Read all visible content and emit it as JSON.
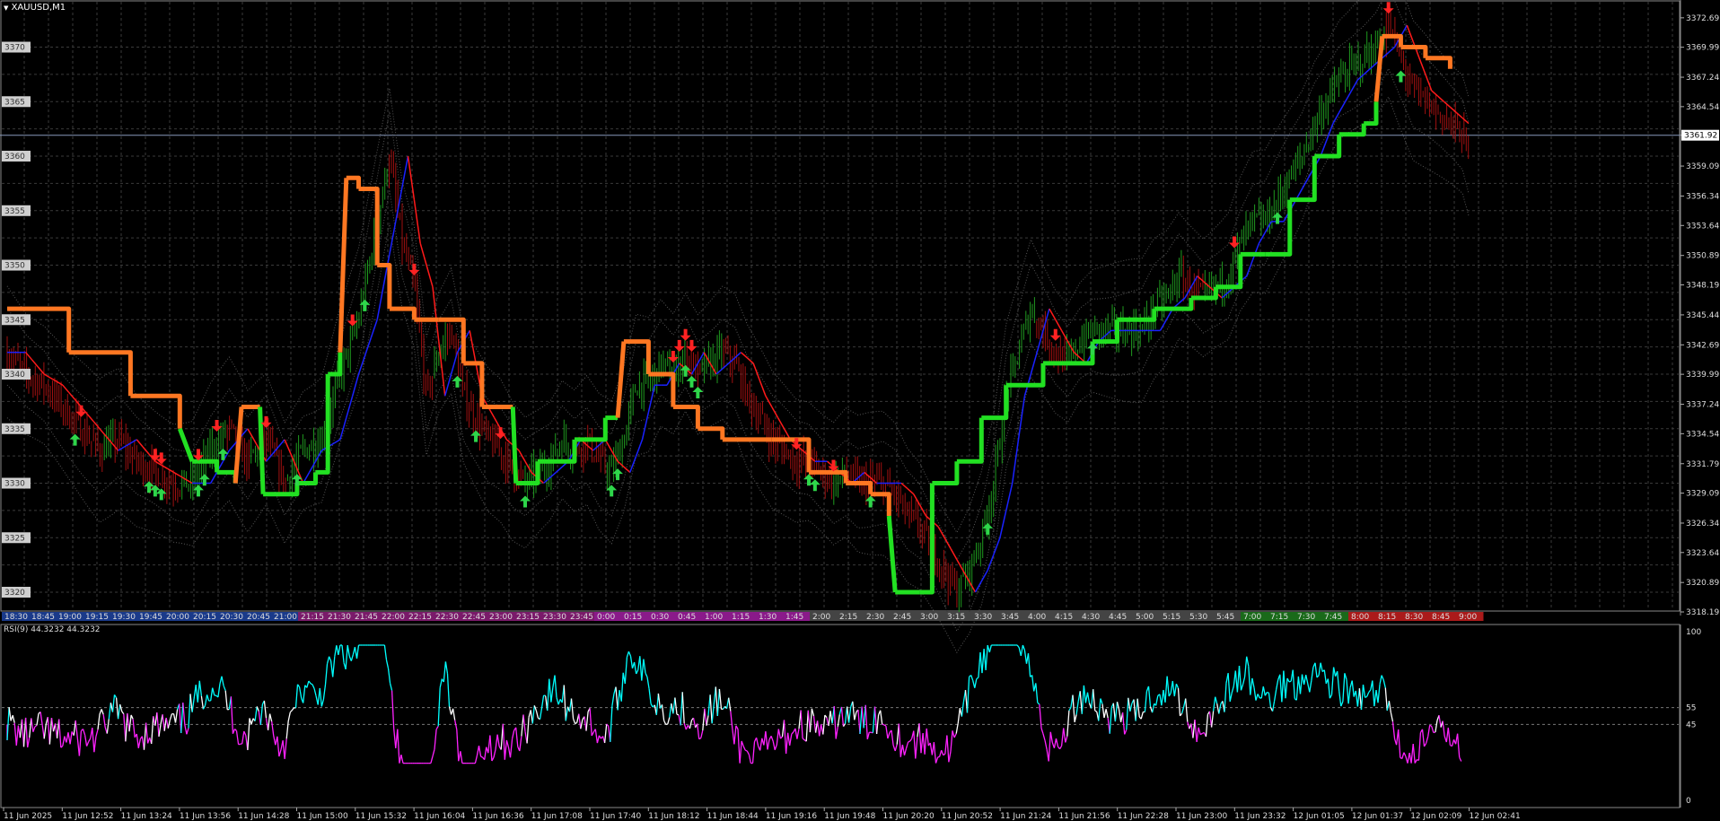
{
  "chart_title": "XAUUSD,M1",
  "rsi_label": "RSI(9) 44.3232 44.3232",
  "colors": {
    "background": "#000000",
    "grid": "#3a3a3a",
    "bull": "#1f9a1f",
    "bear": "#a01010",
    "supertrend_up": "#22e022",
    "supertrend_down": "#ff7722",
    "rsi_high": "#00ffff",
    "rsi_mid": "#ffffff",
    "rsi_low": "#ff22ff",
    "ma_blue": "#1a22ff",
    "ma_red": "#ff1a1a"
  },
  "price_axis": {
    "ticks": [
      "3372.69",
      "3369.99",
      "3367.24",
      "3364.54",
      "3361.92",
      "3359.09",
      "3356.34",
      "3353.64",
      "3350.89",
      "3348.19",
      "3345.44",
      "3342.69",
      "3339.99",
      "3337.24",
      "3334.54",
      "3331.79",
      "3329.09",
      "3326.34",
      "3323.64",
      "3320.89",
      "3318.19"
    ],
    "current_price": "3361.92"
  },
  "left_price_labels": [
    "3370",
    "3365",
    "3360",
    "3355",
    "3350",
    "3345",
    "3340",
    "3335",
    "3330",
    "3325",
    "3320"
  ],
  "session_times": [
    {
      "t": "18:30",
      "c": "#1a3a8a"
    },
    {
      "t": "18:45",
      "c": "#1a3a8a"
    },
    {
      "t": "19:00",
      "c": "#1a3a8a"
    },
    {
      "t": "19:15",
      "c": "#1a3a8a"
    },
    {
      "t": "19:30",
      "c": "#1a3a8a"
    },
    {
      "t": "19:45",
      "c": "#1a3a8a"
    },
    {
      "t": "20:00",
      "c": "#1a3a8a"
    },
    {
      "t": "20:15",
      "c": "#1a3a8a"
    },
    {
      "t": "20:30",
      "c": "#1a3a8a"
    },
    {
      "t": "20:45",
      "c": "#1a3a8a"
    },
    {
      "t": "21:00",
      "c": "#1a3a8a"
    },
    {
      "t": "21:15",
      "c": "#7a1a6a"
    },
    {
      "t": "21:30",
      "c": "#7a1a6a"
    },
    {
      "t": "21:45",
      "c": "#7a1a6a"
    },
    {
      "t": "22:00",
      "c": "#7a1a6a"
    },
    {
      "t": "22:15",
      "c": "#7a1a6a"
    },
    {
      "t": "22:30",
      "c": "#7a1a6a"
    },
    {
      "t": "22:45",
      "c": "#7a1a6a"
    },
    {
      "t": "23:00",
      "c": "#7a1a6a"
    },
    {
      "t": "23:15",
      "c": "#7a1a6a"
    },
    {
      "t": "23:30",
      "c": "#7a1a6a"
    },
    {
      "t": "23:45",
      "c": "#7a1a6a"
    },
    {
      "t": "0:00",
      "c": "#8a1a8a"
    },
    {
      "t": "0:15",
      "c": "#8a1a8a"
    },
    {
      "t": "0:30",
      "c": "#8a1a8a"
    },
    {
      "t": "0:45",
      "c": "#8a1a8a"
    },
    {
      "t": "1:00",
      "c": "#8a1a8a"
    },
    {
      "t": "1:15",
      "c": "#8a1a8a"
    },
    {
      "t": "1:30",
      "c": "#8a1a8a"
    },
    {
      "t": "1:45",
      "c": "#8a1a8a"
    },
    {
      "t": "2:00",
      "c": "#444444"
    },
    {
      "t": "2:15",
      "c": "#444444"
    },
    {
      "t": "2:30",
      "c": "#444444"
    },
    {
      "t": "2:45",
      "c": "#444444"
    },
    {
      "t": "3:00",
      "c": "#444444"
    },
    {
      "t": "3:15",
      "c": "#444444"
    },
    {
      "t": "3:30",
      "c": "#444444"
    },
    {
      "t": "3:45",
      "c": "#444444"
    },
    {
      "t": "4:00",
      "c": "#444444"
    },
    {
      "t": "4:15",
      "c": "#444444"
    },
    {
      "t": "4:30",
      "c": "#444444"
    },
    {
      "t": "4:45",
      "c": "#444444"
    },
    {
      "t": "5:00",
      "c": "#444444"
    },
    {
      "t": "5:15",
      "c": "#444444"
    },
    {
      "t": "5:30",
      "c": "#444444"
    },
    {
      "t": "5:45",
      "c": "#444444"
    },
    {
      "t": "7:00",
      "c": "#1a6a1a"
    },
    {
      "t": "7:15",
      "c": "#1a6a1a"
    },
    {
      "t": "7:30",
      "c": "#1a6a1a"
    },
    {
      "t": "7:45",
      "c": "#1a6a1a"
    },
    {
      "t": "8:00",
      "c": "#aa1a1a"
    },
    {
      "t": "8:15",
      "c": "#aa1a1a"
    },
    {
      "t": "8:30",
      "c": "#aa1a1a"
    },
    {
      "t": "8:45",
      "c": "#aa1a1a"
    },
    {
      "t": "9:00",
      "c": "#aa1a1a"
    }
  ],
  "time_axis": [
    "11 Jun 2025",
    "11 Jun 12:52",
    "11 Jun 13:24",
    "11 Jun 13:56",
    "11 Jun 14:28",
    "11 Jun 15:00",
    "11 Jun 15:32",
    "11 Jun 16:04",
    "11 Jun 16:36",
    "11 Jun 17:08",
    "11 Jun 17:40",
    "11 Jun 18:12",
    "11 Jun 18:44",
    "11 Jun 19:16",
    "11 Jun 19:48",
    "11 Jun 20:20",
    "11 Jun 20:52",
    "11 Jun 21:24",
    "11 Jun 21:56",
    "11 Jun 22:28",
    "11 Jun 23:00",
    "11 Jun 23:32",
    "12 Jun 01:05",
    "12 Jun 01:37",
    "12 Jun 02:09",
    "12 Jun 02:41"
  ],
  "rsi_axis": [
    "100",
    "55",
    "45",
    "0"
  ],
  "chart_data": {
    "type": "line",
    "title": "XAUUSD,M1",
    "ylim": [
      3318.19,
      3373.5
    ],
    "price_path": [
      [
        0,
        3342
      ],
      [
        3,
        3340
      ],
      [
        6,
        3339
      ],
      [
        9,
        3337
      ],
      [
        12,
        3335
      ],
      [
        15,
        3333
      ],
      [
        18,
        3334
      ],
      [
        21,
        3332
      ],
      [
        24,
        3331
      ],
      [
        27,
        3330
      ],
      [
        30,
        3330
      ],
      [
        33,
        3333
      ],
      [
        36,
        3335
      ],
      [
        39,
        3332
      ],
      [
        42,
        3334
      ],
      [
        45,
        3330
      ],
      [
        48,
        3333
      ],
      [
        51,
        3334
      ],
      [
        54,
        3340
      ],
      [
        57,
        3345
      ],
      [
        60,
        3354
      ],
      [
        62,
        3360
      ],
      [
        64,
        3352
      ],
      [
        66,
        3348
      ],
      [
        68,
        3338
      ],
      [
        70,
        3342
      ],
      [
        72,
        3344
      ],
      [
        74,
        3338
      ],
      [
        76,
        3336
      ],
      [
        78,
        3334
      ],
      [
        80,
        3333
      ],
      [
        82,
        3331
      ],
      [
        84,
        3330
      ],
      [
        86,
        3331
      ],
      [
        88,
        3332
      ],
      [
        90,
        3334
      ],
      [
        92,
        3333
      ],
      [
        94,
        3334
      ],
      [
        96,
        3332
      ],
      [
        98,
        3331
      ],
      [
        100,
        3334
      ],
      [
        102,
        3339
      ],
      [
        104,
        3339
      ],
      [
        106,
        3341
      ],
      [
        108,
        3340
      ],
      [
        110,
        3342
      ],
      [
        112,
        3340
      ],
      [
        114,
        3341
      ],
      [
        116,
        3342
      ],
      [
        118,
        3341
      ],
      [
        120,
        3338
      ],
      [
        122,
        3336
      ],
      [
        124,
        3334
      ],
      [
        126,
        3333
      ],
      [
        128,
        3332
      ],
      [
        130,
        3332
      ],
      [
        132,
        3331
      ],
      [
        134,
        3330
      ],
      [
        136,
        3331
      ],
      [
        138,
        3330
      ],
      [
        140,
        3330
      ],
      [
        142,
        3330
      ],
      [
        144,
        3329
      ],
      [
        146,
        3327
      ],
      [
        148,
        3326
      ],
      [
        150,
        3324
      ],
      [
        152,
        3322
      ],
      [
        154,
        3320
      ],
      [
        156,
        3322
      ],
      [
        158,
        3325
      ],
      [
        160,
        3330
      ],
      [
        162,
        3338
      ],
      [
        164,
        3342
      ],
      [
        166,
        3346
      ],
      [
        168,
        3344
      ],
      [
        170,
        3342
      ],
      [
        172,
        3341
      ],
      [
        174,
        3343
      ],
      [
        176,
        3344
      ],
      [
        178,
        3344
      ],
      [
        180,
        3344
      ],
      [
        182,
        3344
      ],
      [
        184,
        3344
      ],
      [
        186,
        3346
      ],
      [
        188,
        3347
      ],
      [
        190,
        3349
      ],
      [
        192,
        3348
      ],
      [
        194,
        3347
      ],
      [
        196,
        3348
      ],
      [
        198,
        3349
      ],
      [
        200,
        3352
      ],
      [
        202,
        3354
      ],
      [
        204,
        3354
      ],
      [
        206,
        3356
      ],
      [
        208,
        3358
      ],
      [
        210,
        3360
      ],
      [
        212,
        3363
      ],
      [
        214,
        3365
      ],
      [
        216,
        3367
      ],
      [
        218,
        3368
      ],
      [
        220,
        3369
      ],
      [
        222,
        3370
      ],
      [
        224,
        3372
      ],
      [
        226,
        3369
      ],
      [
        228,
        3366
      ],
      [
        230,
        3365
      ],
      [
        232,
        3364
      ],
      [
        234,
        3363
      ],
      [
        236,
        3362
      ],
      [
        237,
        3360
      ]
    ],
    "supertrend": [
      [
        0,
        3346,
        "down"
      ],
      [
        10,
        3342,
        "down"
      ],
      [
        20,
        3338,
        "down"
      ],
      [
        28,
        3335,
        "down"
      ],
      [
        30,
        3332,
        "up"
      ],
      [
        34,
        3331,
        "up"
      ],
      [
        37,
        3330,
        "up"
      ],
      [
        38,
        3337,
        "down"
      ],
      [
        41,
        3337,
        "down"
      ],
      [
        41.5,
        3329,
        "up"
      ],
      [
        47,
        3330,
        "up"
      ],
      [
        50,
        3331,
        "up"
      ],
      [
        52,
        3340,
        "up"
      ],
      [
        54,
        3342,
        "up"
      ],
      [
        55,
        3358,
        "down"
      ],
      [
        57,
        3357,
        "down"
      ],
      [
        60,
        3350,
        "down"
      ],
      [
        62,
        3346,
        "down"
      ],
      [
        66,
        3345,
        "down"
      ],
      [
        70,
        3345,
        "down"
      ],
      [
        74,
        3341,
        "down"
      ],
      [
        77,
        3337,
        "down"
      ],
      [
        82,
        3337,
        "down"
      ],
      [
        82.5,
        3330,
        "up"
      ],
      [
        86,
        3332,
        "up"
      ],
      [
        92,
        3334,
        "up"
      ],
      [
        97,
        3336,
        "up"
      ],
      [
        99,
        3336,
        "up"
      ],
      [
        100,
        3343,
        "down"
      ],
      [
        104,
        3340,
        "down"
      ],
      [
        108,
        3337,
        "down"
      ],
      [
        112,
        3335,
        "down"
      ],
      [
        116,
        3334,
        "down"
      ],
      [
        124,
        3334,
        "down"
      ],
      [
        130,
        3331,
        "down"
      ],
      [
        136,
        3330,
        "down"
      ],
      [
        140,
        3329,
        "down"
      ],
      [
        143,
        3327,
        "down"
      ],
      [
        144,
        3320,
        "up"
      ],
      [
        148,
        3320,
        "up"
      ],
      [
        150,
        3330,
        "up"
      ],
      [
        154,
        3332,
        "up"
      ],
      [
        158,
        3336,
        "up"
      ],
      [
        162,
        3339,
        "up"
      ],
      [
        168,
        3341,
        "up"
      ],
      [
        172,
        3341,
        "up"
      ],
      [
        176,
        3343,
        "up"
      ],
      [
        180,
        3345,
        "up"
      ],
      [
        186,
        3346,
        "up"
      ],
      [
        192,
        3347,
        "up"
      ],
      [
        196,
        3348,
        "up"
      ],
      [
        200,
        3351,
        "up"
      ],
      [
        204,
        3351,
        "up"
      ],
      [
        208,
        3356,
        "up"
      ],
      [
        212,
        3360,
        "up"
      ],
      [
        216,
        3362,
        "up"
      ],
      [
        220,
        3363,
        "up"
      ],
      [
        222,
        3365,
        "up"
      ],
      [
        223,
        3371,
        "down"
      ],
      [
        226,
        3370,
        "down"
      ],
      [
        230,
        3369,
        "down"
      ],
      [
        234,
        3368,
        "down"
      ]
    ]
  }
}
